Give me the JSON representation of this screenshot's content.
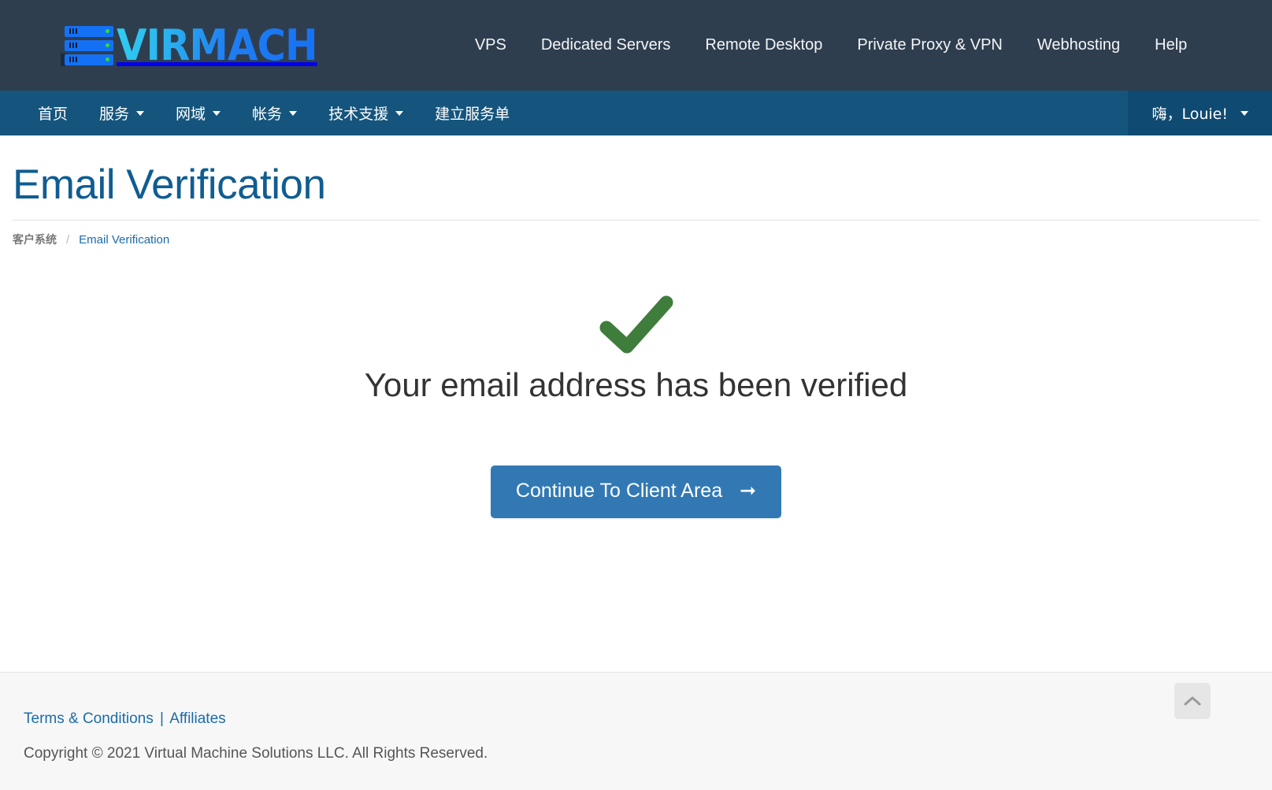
{
  "header": {
    "logo_text": "VIRMACH",
    "logo_icon": "server-rack-icon",
    "nav": [
      {
        "label": "VPS"
      },
      {
        "label": "Dedicated Servers"
      },
      {
        "label": "Remote Desktop"
      },
      {
        "label": "Private Proxy & VPN"
      },
      {
        "label": "Webhosting"
      },
      {
        "label": "Help"
      }
    ]
  },
  "subnav": {
    "items": [
      {
        "label": "首页",
        "has_caret": false
      },
      {
        "label": "服务",
        "has_caret": true
      },
      {
        "label": "网域",
        "has_caret": true
      },
      {
        "label": "帐务",
        "has_caret": true
      },
      {
        "label": "技术支援",
        "has_caret": true
      },
      {
        "label": "建立服务单",
        "has_caret": false
      }
    ],
    "user_menu": {
      "label": "嗨，Louie!",
      "caret_icon": "chevron-down-icon"
    }
  },
  "page": {
    "title": "Email Verification",
    "breadcrumb": {
      "root": "客户系统",
      "separator": "/",
      "current": "Email Verification"
    }
  },
  "content": {
    "status_icon": "green-checkmark-icon",
    "message": "Your email address has been verified",
    "cta_label": "Continue To Client Area",
    "cta_arrow_icon": "arrow-right-icon"
  },
  "footer": {
    "terms_label": "Terms & Conditions",
    "pipe": "|",
    "affiliates_label": "Affiliates",
    "copyright": "Copyright © 2021 Virtual Machine Solutions LLC. All Rights Reserved.",
    "scroll_top_icon": "chevron-up-icon"
  },
  "colors": {
    "header_bg": "#2f3e4f",
    "subnav_bg": "#15557d",
    "user_menu_bg": "#0f4a72",
    "title_blue": "#0f5d92",
    "link_blue": "#1b6ca8",
    "button_blue": "#3279b4",
    "check_green": "#3f7d3c",
    "footer_bg": "#f7f7f7"
  }
}
